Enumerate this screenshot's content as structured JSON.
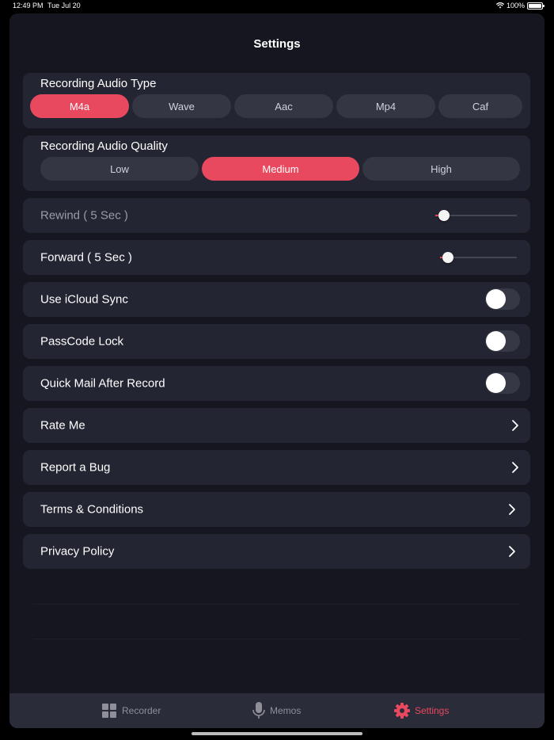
{
  "status": {
    "time": "12:49 PM",
    "date": "Tue Jul 20",
    "battery": "100%"
  },
  "title": "Settings",
  "audio_type": {
    "label": "Recording Audio Type",
    "options": [
      "M4a",
      "Wave",
      "Aac",
      "Mp4",
      "Caf"
    ],
    "selected": "M4a"
  },
  "audio_quality": {
    "label": "Recording Audio Quality",
    "options": [
      "Low",
      "Medium",
      "High"
    ],
    "selected": "Medium"
  },
  "rewind": {
    "label": "Rewind ( 5 Sec )",
    "level": 0.1
  },
  "forward": {
    "label": "Forward ( 5 Sec )",
    "level": 0.1
  },
  "toggles": {
    "icloud": {
      "label": "Use iCloud Sync",
      "on": false
    },
    "passcode": {
      "label": "PassCode Lock",
      "on": false
    },
    "quickmail": {
      "label": "Quick Mail After Record",
      "on": false
    }
  },
  "links": {
    "rate": "Rate Me",
    "bug": "Report a Bug",
    "terms": "Terms & Conditions",
    "privacy": "Privacy Policy"
  },
  "tabs": {
    "recorder": "Recorder",
    "memos": "Memos",
    "settings": "Settings",
    "active": "settings"
  },
  "colors": {
    "accent": "#e9495f",
    "background": "#15161f",
    "card": "#232532"
  },
  "icons": {
    "recorder": "grid-icon",
    "memos": "microphone-icon",
    "settings": "gear-icon",
    "chevron": "chevron-right-icon"
  }
}
